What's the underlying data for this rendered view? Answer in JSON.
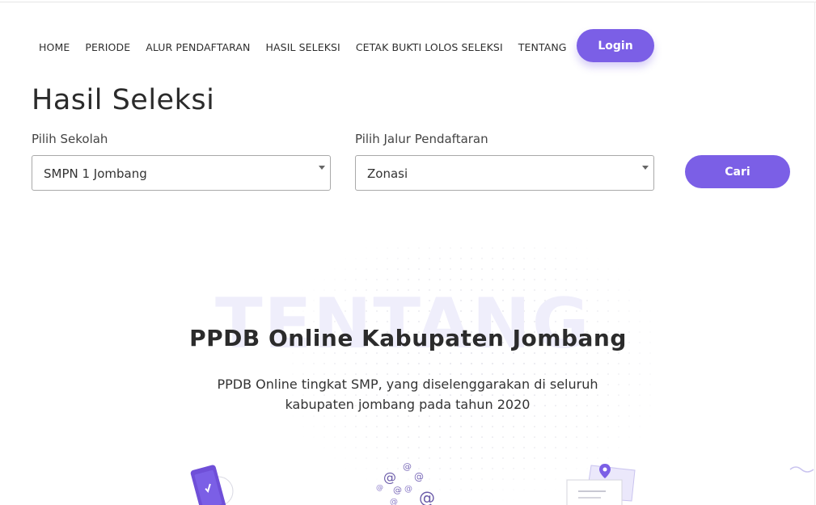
{
  "nav": {
    "items": [
      {
        "label": "HOME"
      },
      {
        "label": "PERIODE"
      },
      {
        "label": "ALUR PENDAFTARAN"
      },
      {
        "label": "HASIL SELEKSI"
      },
      {
        "label": "CETAK BUKTI LOLOS SELEKSI"
      },
      {
        "label": "TENTANG"
      }
    ],
    "login_label": "Login"
  },
  "page": {
    "title": "Hasil Seleksi"
  },
  "filters": {
    "school_label": "Pilih Sekolah",
    "school_value": "SMPN 1 Jombang",
    "route_label": "Pilih Jalur Pendaftaran",
    "route_value": "Zonasi",
    "search_label": "Cari"
  },
  "about": {
    "watermark": "TENTANG",
    "title": "PPDB Online Kabupaten Jombang",
    "description_line1": "PPDB Online tingkat SMP, yang diselenggarakan di seluruh",
    "description_line2": "kabupaten jombang pada tahun 2020"
  },
  "colors": {
    "accent": "#7b5fe6",
    "watermark": "#efeefb"
  },
  "icons": [
    "chevron-down-icon",
    "phone-illustration-icon",
    "email-illustration-icon",
    "map-illustration-icon"
  ]
}
